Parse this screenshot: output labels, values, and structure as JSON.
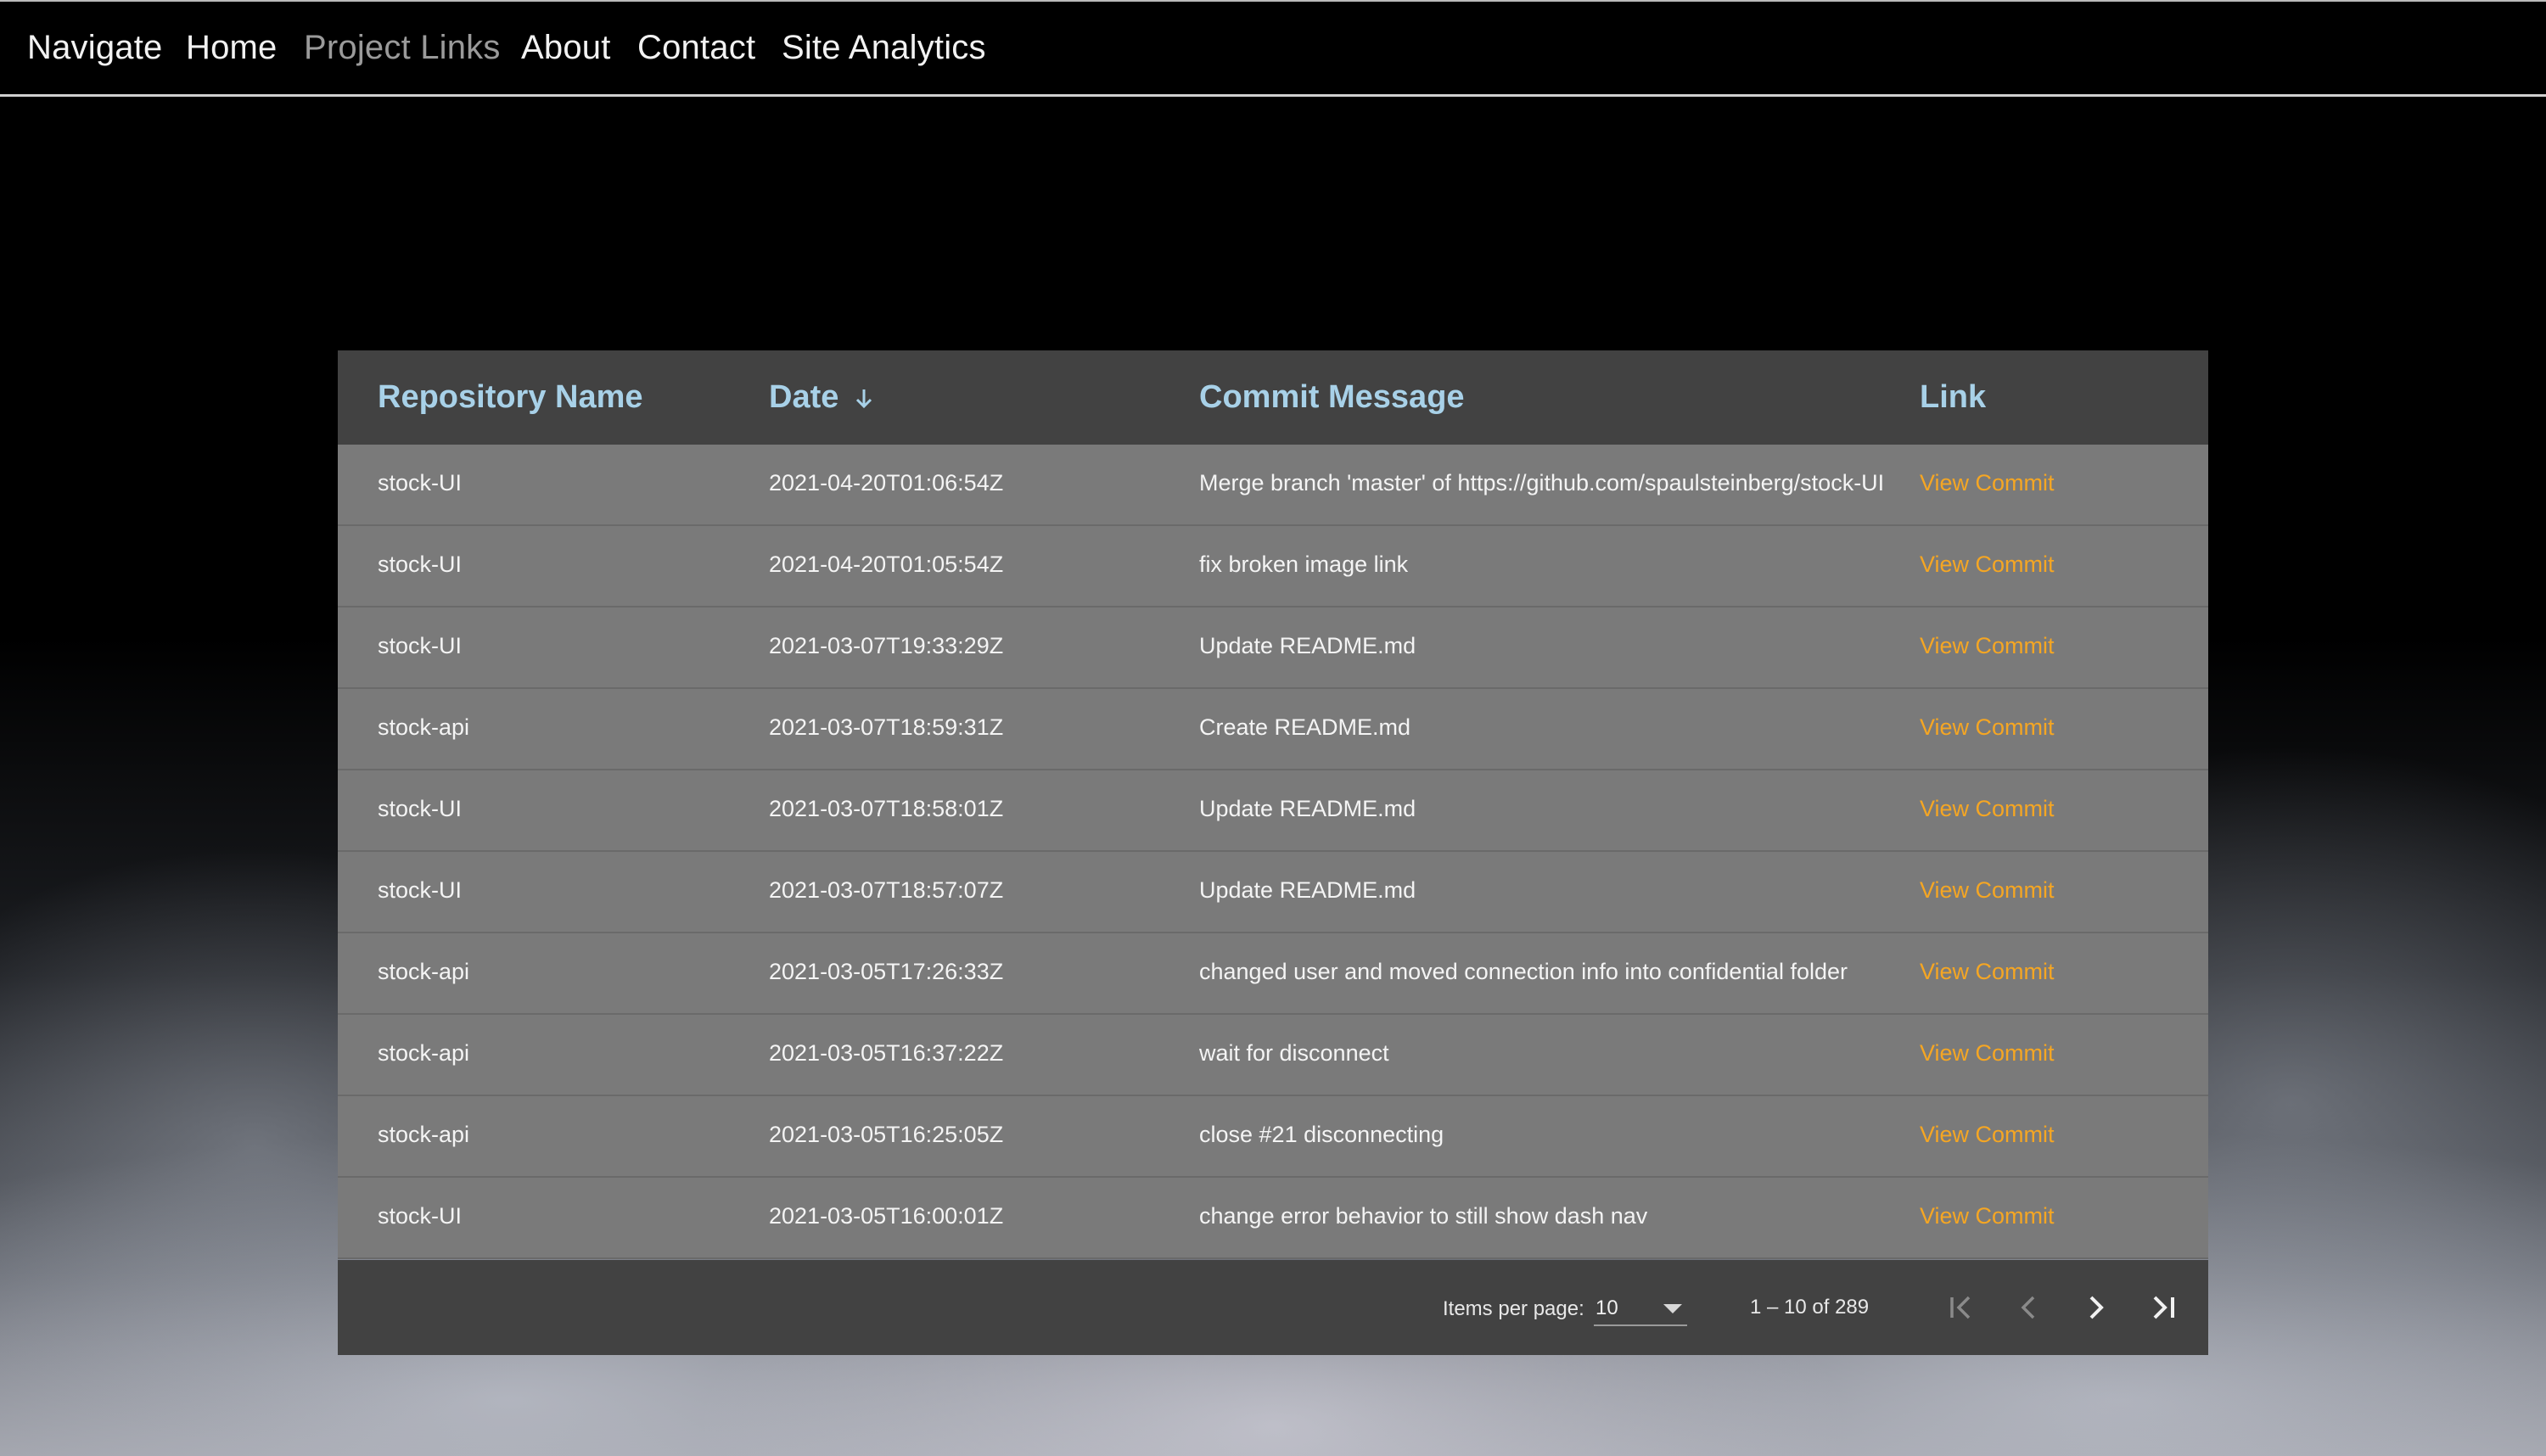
{
  "nav": {
    "items": [
      {
        "label": "Navigate",
        "active": false
      },
      {
        "label": "Home",
        "active": false
      },
      {
        "label": "Project Links",
        "active": true
      },
      {
        "label": "About",
        "active": false
      },
      {
        "label": "Contact",
        "active": false
      },
      {
        "label": "Site Analytics",
        "active": false
      }
    ]
  },
  "table": {
    "columns": {
      "repo": "Repository Name",
      "date": "Date",
      "message": "Commit Message",
      "link": "Link"
    },
    "sort": {
      "column": "date",
      "direction": "descending",
      "icon": "arrow-down-icon"
    },
    "rows": [
      {
        "repo": "stock-UI",
        "date": "2021-04-20T01:06:54Z",
        "message": "Merge branch 'master' of https://github.com/spaulsteinberg/stock-UI",
        "link": "View Commit"
      },
      {
        "repo": "stock-UI",
        "date": "2021-04-20T01:05:54Z",
        "message": "fix broken image link",
        "link": "View Commit"
      },
      {
        "repo": "stock-UI",
        "date": "2021-03-07T19:33:29Z",
        "message": "Update README.md",
        "link": "View Commit"
      },
      {
        "repo": "stock-api",
        "date": "2021-03-07T18:59:31Z",
        "message": "Create README.md",
        "link": "View Commit"
      },
      {
        "repo": "stock-UI",
        "date": "2021-03-07T18:58:01Z",
        "message": "Update README.md",
        "link": "View Commit"
      },
      {
        "repo": "stock-UI",
        "date": "2021-03-07T18:57:07Z",
        "message": "Update README.md",
        "link": "View Commit"
      },
      {
        "repo": "stock-api",
        "date": "2021-03-05T17:26:33Z",
        "message": "changed user and moved connection info into confidential folder",
        "link": "View Commit"
      },
      {
        "repo": "stock-api",
        "date": "2021-03-05T16:37:22Z",
        "message": "wait for disconnect",
        "link": "View Commit"
      },
      {
        "repo": "stock-api",
        "date": "2021-03-05T16:25:05Z",
        "message": "close #21 disconnecting",
        "link": "View Commit"
      },
      {
        "repo": "stock-UI",
        "date": "2021-03-05T16:00:01Z",
        "message": "change error behavior to still show dash nav",
        "link": "View Commit"
      }
    ]
  },
  "paginator": {
    "items_per_page_label": "Items per page:",
    "items_per_page_value": "10",
    "range_label": "1 – 10 of 289",
    "buttons": {
      "first": "first-page-icon",
      "previous": "previous-page-icon",
      "next": "next-page-icon",
      "last": "last-page-icon"
    }
  },
  "colors": {
    "header_text": "#a8d1e8",
    "link": "#f5a623",
    "header_bg": "#424242",
    "row_bg": "#7a7a7a",
    "nav_active": "#9a9a9a"
  }
}
